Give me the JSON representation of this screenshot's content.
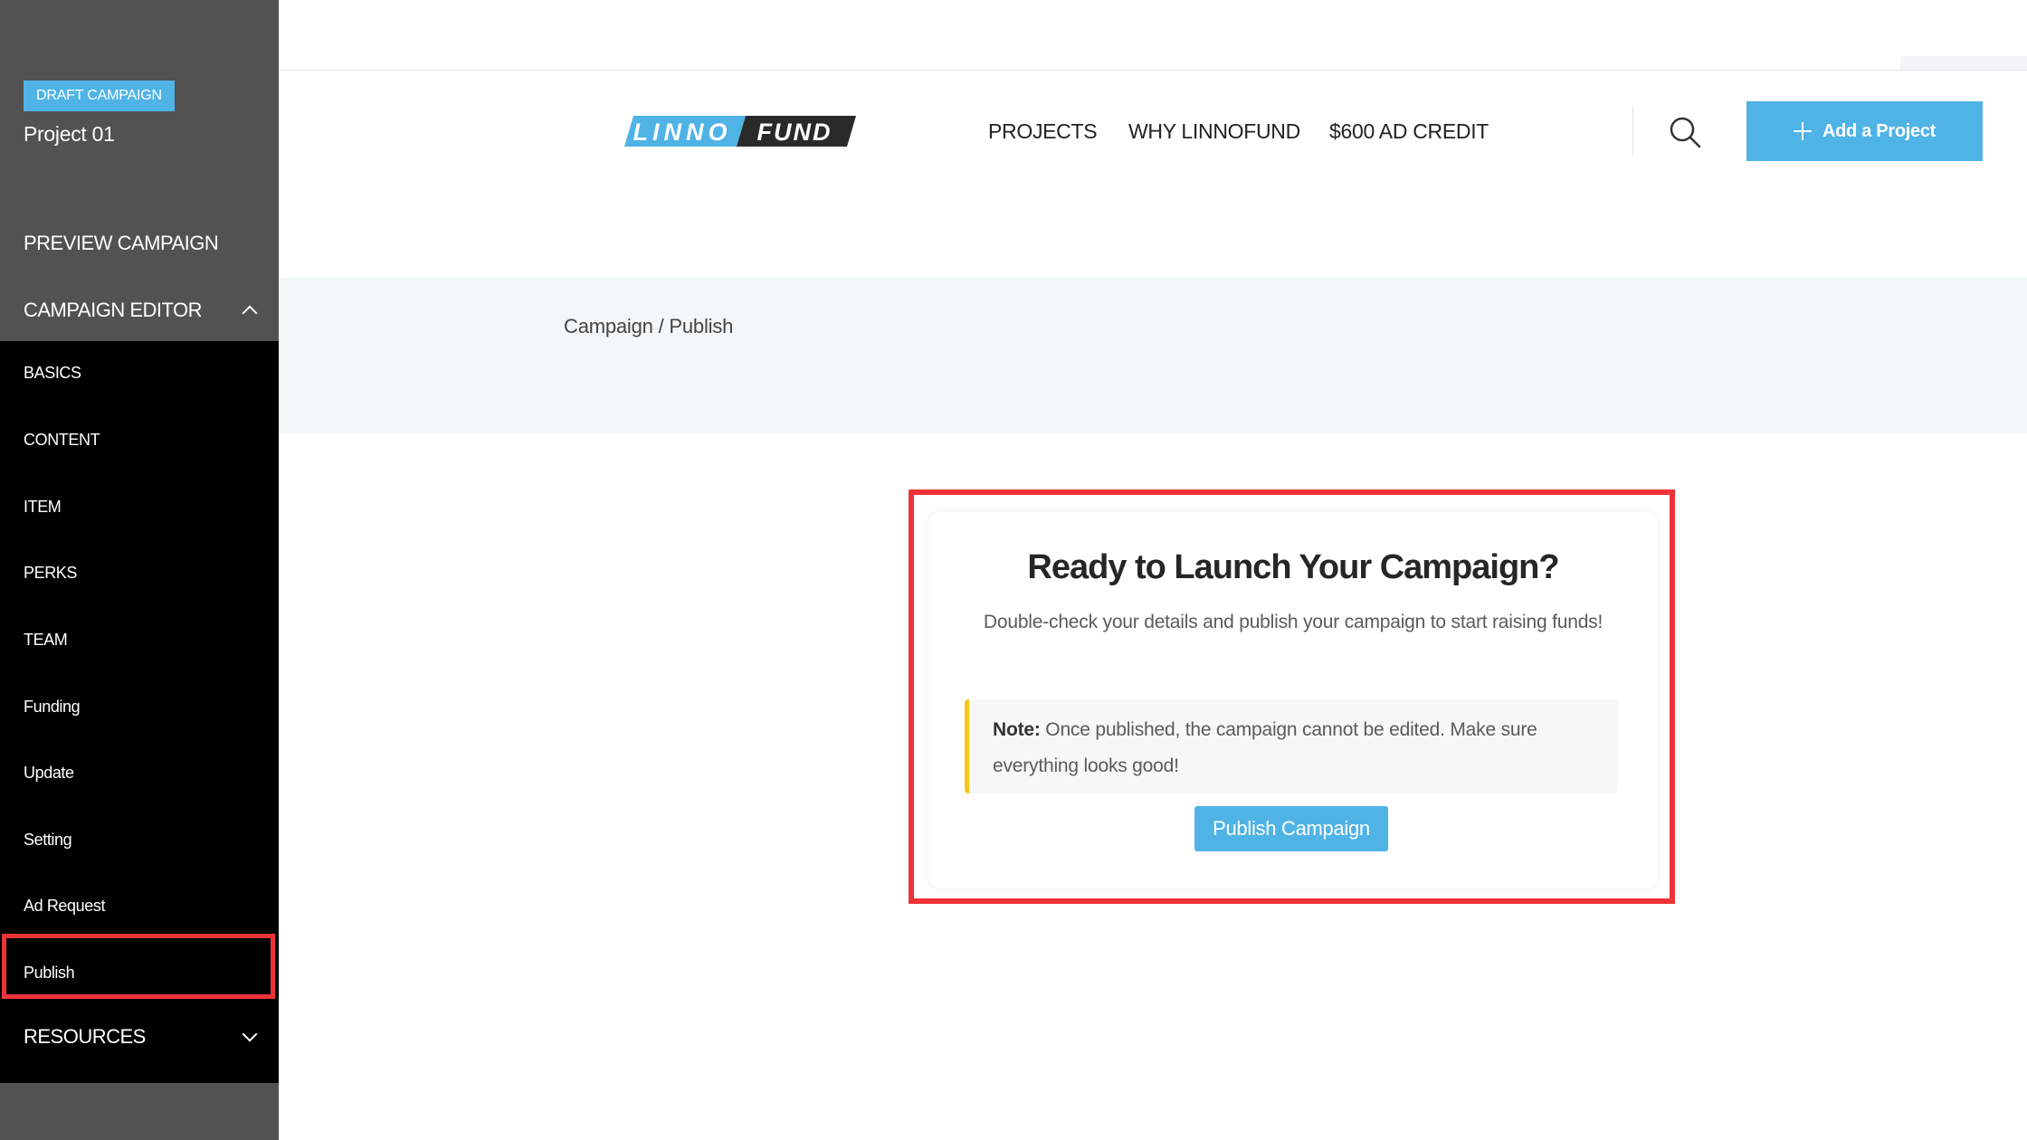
{
  "sidebar": {
    "badge": "DRAFT CAMPAIGN",
    "project_name": "Project 01",
    "preview_label": "PREVIEW CAMPAIGN",
    "editor_label": "CAMPAIGN EDITOR",
    "items": [
      {
        "label": "BASICS"
      },
      {
        "label": "CONTENT"
      },
      {
        "label": "ITEM"
      },
      {
        "label": "PERKS"
      },
      {
        "label": "TEAM"
      },
      {
        "label": "Funding"
      },
      {
        "label": "Update"
      },
      {
        "label": "Setting"
      },
      {
        "label": "Ad Request"
      },
      {
        "label": "Publish"
      }
    ],
    "active_item": "Publish",
    "resources_label": "RESOURCES"
  },
  "header": {
    "logo_left": "LINNO",
    "logo_right": "FUND",
    "nav": [
      {
        "label": "PROJECTS"
      },
      {
        "label": "WHY LINNOFUND"
      },
      {
        "label": "$600 AD CREDIT"
      }
    ],
    "search_icon": "search-icon",
    "add_button_label": "Add a Project"
  },
  "breadcrumb": "Campaign / Publish",
  "card": {
    "title": "Ready to Launch Your Campaign?",
    "description": "Double-check your details and publish your campaign to start raising funds!",
    "note_label": "Note:",
    "note_text": " Once published, the campaign cannot be edited. Make sure everything looks good!",
    "publish_button": "Publish Campaign"
  },
  "colors": {
    "accent": "#4fb3e6",
    "sidebar_bg": "#525252",
    "submenu_bg": "#000000",
    "highlight": "#ee3338",
    "note_border": "#f5c518"
  }
}
